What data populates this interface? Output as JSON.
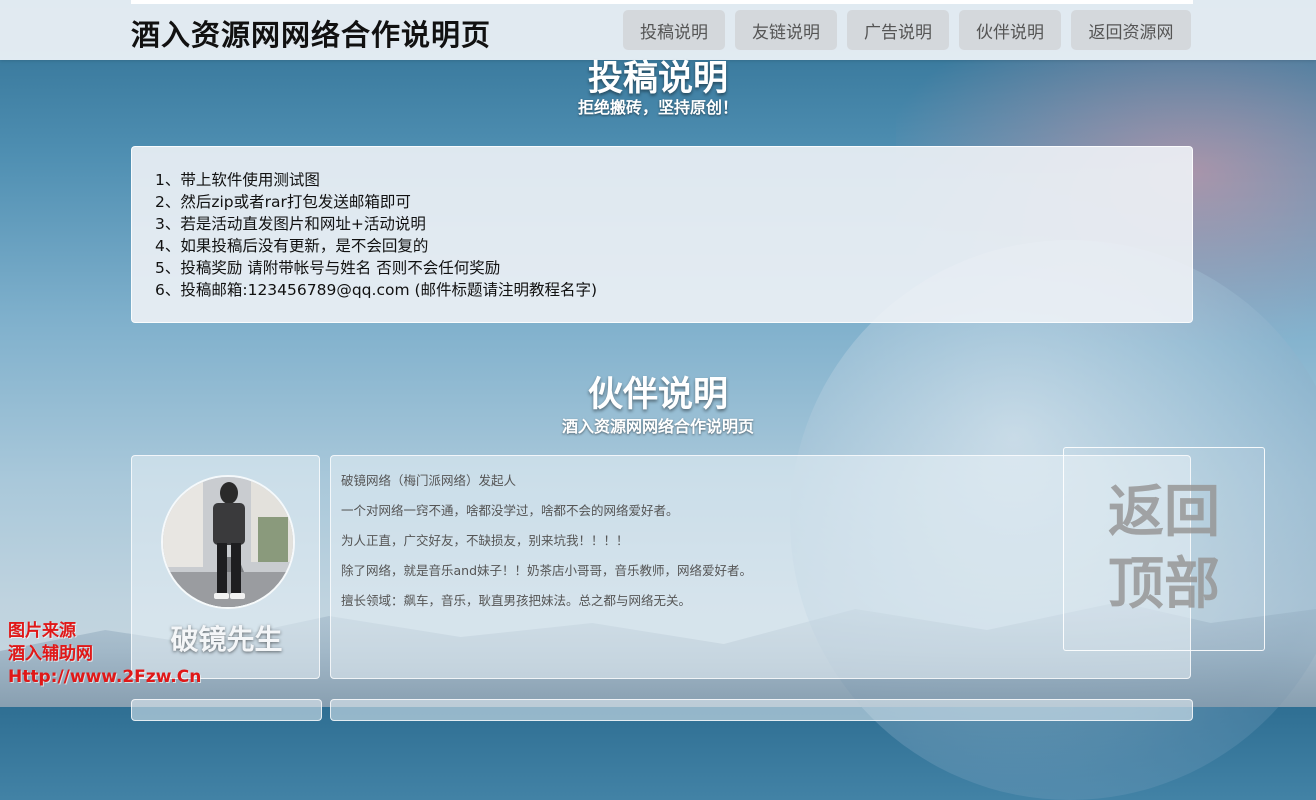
{
  "header": {
    "site_title": "酒入资源网网络合作说明页",
    "nav": [
      {
        "label": "投稿说明"
      },
      {
        "label": "友链说明"
      },
      {
        "label": "广告说明"
      },
      {
        "label": "伙伴说明"
      },
      {
        "label": "返回资源网"
      }
    ]
  },
  "contribute": {
    "title": "投稿说明",
    "subtitle": "拒绝搬砖，坚持原创！",
    "rules": [
      "1、带上软件使用测试图",
      "2、然后zip或者rar打包发送邮箱即可",
      "3、若是活动直发图片和网址+活动说明",
      "4、如果投稿后没有更新，是不会回复的",
      "5、投稿奖励 请附带帐号与姓名 否则不会任何奖励",
      "6、投稿邮箱:123456789@qq.com (邮件标题请注明教程名字)"
    ]
  },
  "partner": {
    "title": "伙伴说明",
    "subtitle": "酒入资源网网络合作说明页",
    "card": {
      "name": "破镜先生",
      "bio": [
        "破镜网络（梅门派网络）发起人",
        "一个对网络一窍不通，啥都没学过，啥都不会的网络爱好者。",
        "为人正直，广交好友，不缺损友，别来坑我！！！！",
        "除了网络，就是音乐and妹子！！奶茶店小哥哥，音乐教师，网络爱好者。",
        "擅长领域：飙车，音乐，耿直男孩把妹法。总之都与网络无关。"
      ]
    }
  },
  "back_to_top": {
    "label": "返回顶部"
  },
  "watermark": {
    "line1": "图片来源",
    "line2": "酒入辅助网",
    "line3": "Http://www.2Fzw.Cn"
  }
}
